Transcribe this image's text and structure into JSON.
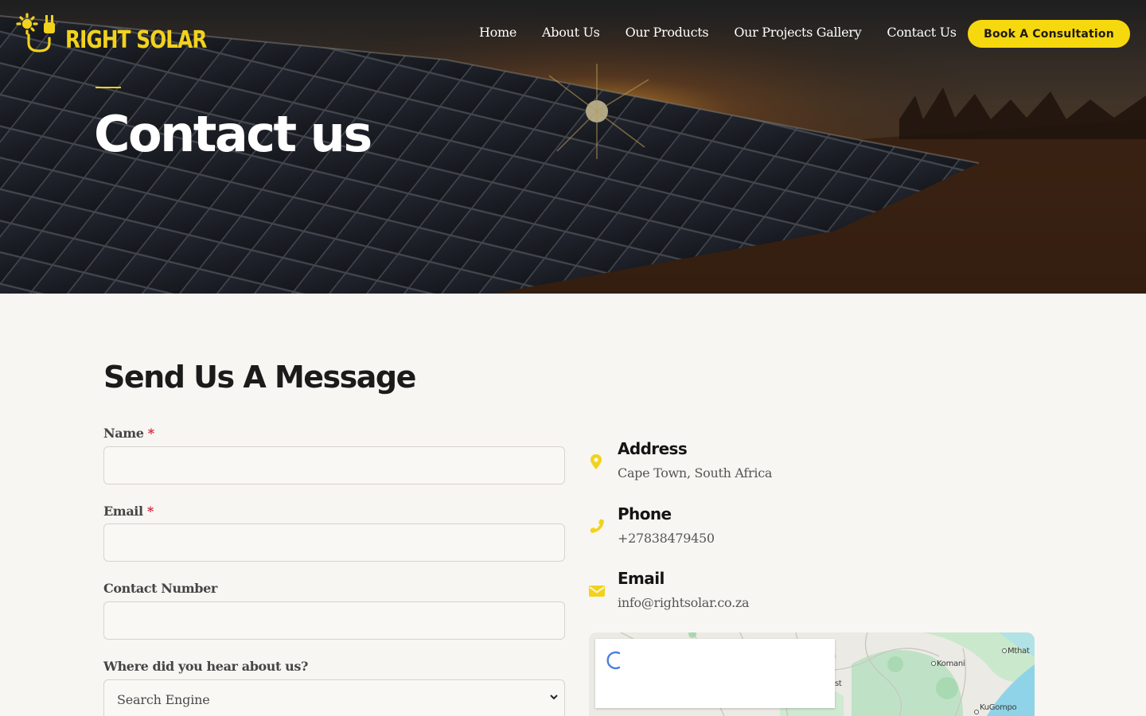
{
  "brand": {
    "name": "RIGHT SOLAR",
    "accent": "#f6d80f"
  },
  "nav": {
    "items": [
      "Home",
      "About Us",
      "Our Products",
      "Our Projects Gallery",
      "Contact Us"
    ],
    "cta": "Book A Consultation"
  },
  "hero": {
    "title": "Contact us"
  },
  "form": {
    "title": "Send Us A Message",
    "fields": {
      "name": {
        "label": "Name",
        "required_mark": "*",
        "value": ""
      },
      "email": {
        "label": "Email",
        "required_mark": "*",
        "value": ""
      },
      "contact": {
        "label": "Contact Number",
        "value": ""
      },
      "source": {
        "label": "Where did you hear about us?",
        "selected": "Search Engine"
      }
    }
  },
  "contact": {
    "address": {
      "title": "Address",
      "value": "Cape Town, South Africa",
      "icon": "map-pin-icon"
    },
    "phone": {
      "title": "Phone",
      "value": "+27838479450",
      "icon": "phone-icon"
    },
    "email": {
      "title": "Email",
      "value": "info@rightsolar.co.za",
      "icon": "envelope-icon"
    }
  },
  "map": {
    "labels": {
      "mthatha": "Mthat",
      "komani": "Komani",
      "kugompo": "KuGompo",
      "west": "st"
    }
  }
}
